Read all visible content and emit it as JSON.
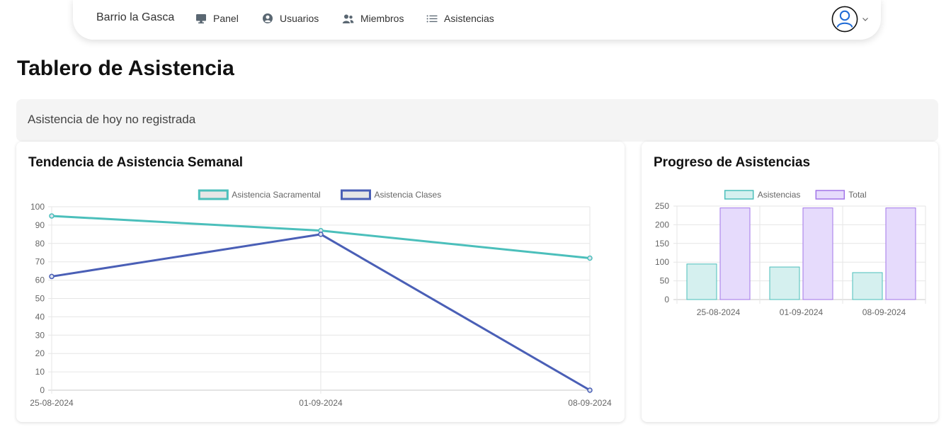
{
  "nav": {
    "brand": "Barrio la Gasca",
    "items": [
      {
        "label": "Panel",
        "icon": "monitor-icon"
      },
      {
        "label": "Usuarios",
        "icon": "user-circle-icon"
      },
      {
        "label": "Miembros",
        "icon": "users-icon"
      },
      {
        "label": "Asistencias",
        "icon": "list-icon"
      }
    ]
  },
  "page_title": "Tablero de Asistencia",
  "alert_text": "Asistencia de hoy no registrada",
  "colors": {
    "teal": "#4bbfbb",
    "blue": "#4a5fb6",
    "purple": "#a275e8",
    "purple_fill": "#e6dbfc",
    "teal_fill": "#d5f0ef"
  },
  "chart_data": [
    {
      "type": "line",
      "title": "Tendencia de Asistencia Semanal",
      "x": [
        "25-08-2024",
        "01-09-2024",
        "08-09-2024"
      ],
      "series": [
        {
          "name": "Asistencia Sacramental",
          "values": [
            95,
            87,
            72
          ],
          "color": "#4bbfbb"
        },
        {
          "name": "Asistencia Clases",
          "values": [
            62,
            85,
            0
          ],
          "color": "#4a5fb6"
        }
      ],
      "ylim": [
        0,
        100
      ],
      "yticks": [
        "0",
        "10",
        "20",
        "30",
        "40",
        "50",
        "60",
        "70",
        "80",
        "90",
        "100"
      ],
      "grid": true,
      "legend": "top-center"
    },
    {
      "type": "bar",
      "title": "Progreso de Asistencias",
      "categories": [
        "25-08-2024",
        "01-09-2024",
        "08-09-2024"
      ],
      "series": [
        {
          "name": "Asistencias",
          "values": [
            95,
            87,
            72
          ],
          "color": "#4bbfbb",
          "fill": "#d5f0ef"
        },
        {
          "name": "Total",
          "values": [
            245,
            245,
            245
          ],
          "color": "#a275e8",
          "fill": "#e6dbfc"
        }
      ],
      "ylim": [
        0,
        250
      ],
      "yticks": [
        "0",
        "50",
        "100",
        "150",
        "200",
        "250"
      ],
      "grid": true,
      "legend": "top-center"
    }
  ]
}
